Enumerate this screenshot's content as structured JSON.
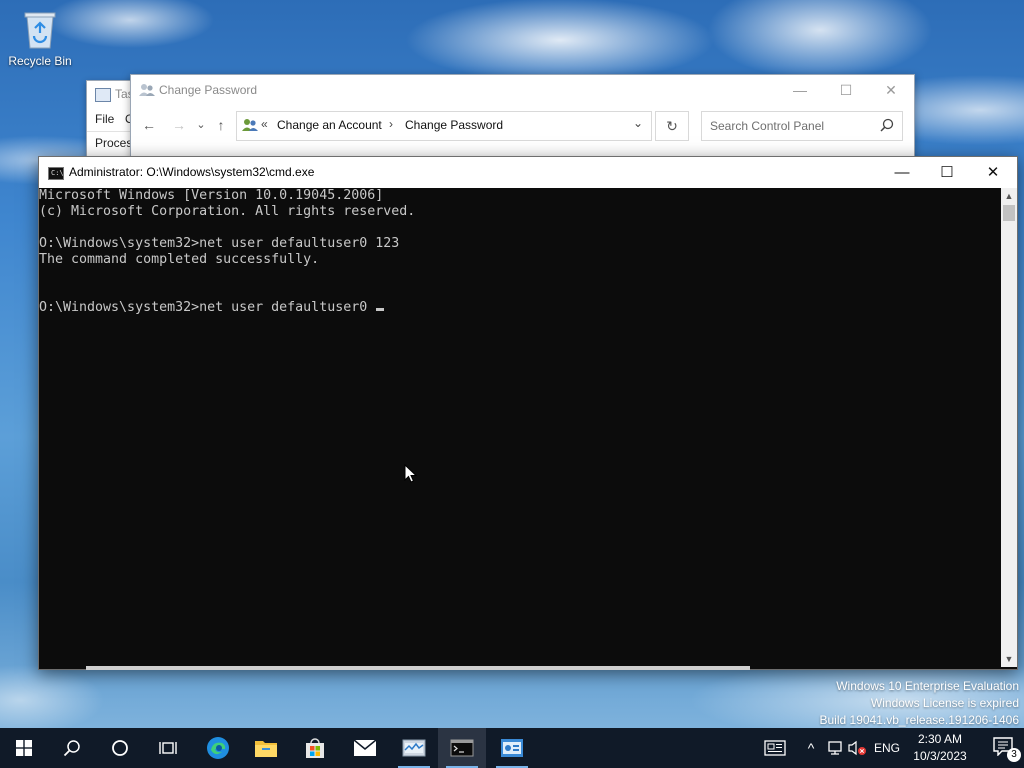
{
  "desktop": {
    "icons": [
      {
        "label": "Recycle Bin",
        "icon": "recycle-bin-icon"
      }
    ],
    "watermark": [
      "Windows 10 Enterprise Evaluation",
      "Windows License is expired",
      "Build 19041.vb_release.191206-1406"
    ]
  },
  "task_manager": {
    "title": "Tas",
    "menu_file": "File",
    "menu_partial": "O",
    "tab_partial": "Proces"
  },
  "control_panel": {
    "title": "Change Password",
    "window_controls": {
      "minimize": "—",
      "maximize": "☐",
      "close": "✕"
    },
    "nav": {
      "back": "←",
      "forward": "→",
      "recent": "⌄",
      "up": "↑"
    },
    "breadcrumb": {
      "overflow": "«",
      "items": [
        "Change an Account",
        "Change Password"
      ],
      "separator": "›",
      "dropdown": "⌄"
    },
    "refresh": "↻",
    "search_placeholder": "Search Control Panel"
  },
  "cmd": {
    "title": "Administrator: O:\\Windows\\system32\\cmd.exe",
    "icon_text": "C:\\",
    "window_controls": {
      "minimize": "—",
      "maximize": "☐",
      "close": "✕"
    },
    "lines": [
      "Microsoft Windows [Version 10.0.19045.2006]",
      "(c) Microsoft Corporation. All rights reserved.",
      "",
      "O:\\Windows\\system32>net user defaultuser0 123",
      "The command completed successfully.",
      "",
      "",
      "O:\\Windows\\system32>net user defaultuser0 "
    ],
    "scroll": {
      "up": "▲",
      "down": "▼"
    }
  },
  "taskbar": {
    "buttons": [
      {
        "name": "start-button",
        "icon": "windows-logo-icon"
      },
      {
        "name": "search-button",
        "icon": "search-icon"
      },
      {
        "name": "cortana-button",
        "icon": "cortana-circle-icon"
      },
      {
        "name": "task-view-button",
        "icon": "task-view-icon"
      },
      {
        "name": "edge-button",
        "icon": "edge-icon"
      },
      {
        "name": "file-explorer-button",
        "icon": "folder-icon"
      },
      {
        "name": "store-button",
        "icon": "store-icon"
      },
      {
        "name": "mail-button",
        "icon": "mail-icon"
      },
      {
        "name": "task-manager-button",
        "icon": "task-manager-icon"
      },
      {
        "name": "cmd-button",
        "icon": "cmd-icon"
      },
      {
        "name": "control-panel-button",
        "icon": "control-panel-icon"
      }
    ],
    "tray": {
      "language": "ENG",
      "overflow": "^",
      "time": "2:30 AM",
      "date": "10/3/2023",
      "notifications_count": "3"
    },
    "accent_color": "#7ab4ea"
  }
}
